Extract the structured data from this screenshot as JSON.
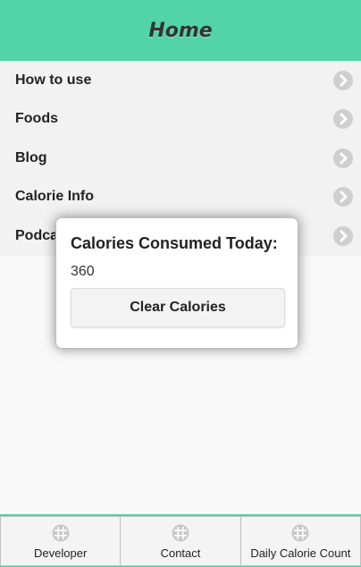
{
  "header": {
    "title": "Home"
  },
  "menu": {
    "items": [
      {
        "label": "How to use"
      },
      {
        "label": "Foods"
      },
      {
        "label": "Blog"
      },
      {
        "label": "Calorie Info"
      },
      {
        "label": "Podcasts"
      }
    ]
  },
  "popup": {
    "title": "Calories Consumed Today:",
    "value": "360",
    "button_label": "Clear Calories"
  },
  "footer": {
    "tabs": [
      {
        "label": "Developer",
        "icon": "grid-icon"
      },
      {
        "label": "Contact",
        "icon": "grid-icon"
      },
      {
        "label": "Daily Calorie Count",
        "icon": "grid-icon"
      }
    ]
  },
  "colors": {
    "accent": "#52d3a8",
    "menu_bg": "#f2f2f2",
    "chevron_bg": "#cfcfcf"
  }
}
